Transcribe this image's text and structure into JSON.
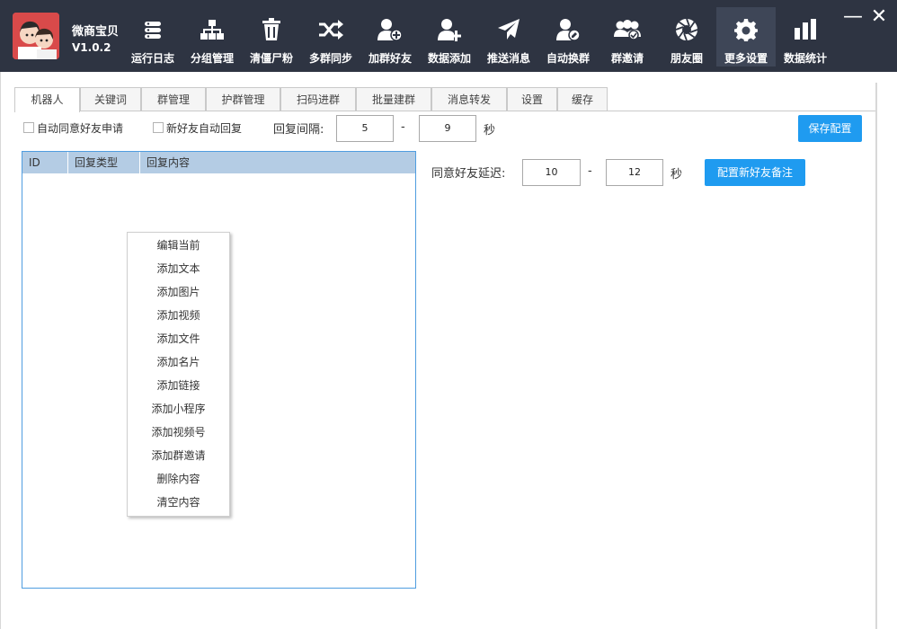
{
  "app": {
    "name": "微商宝贝",
    "version": "V1.0.2"
  },
  "nav": [
    {
      "label": "运行日志",
      "icon": "log-icon"
    },
    {
      "label": "分组管理",
      "icon": "group-tree-icon"
    },
    {
      "label": "清僵尸粉",
      "icon": "trash-icon"
    },
    {
      "label": "多群同步",
      "icon": "shuffle-icon"
    },
    {
      "label": "加群好友",
      "icon": "add-group-friend-icon"
    },
    {
      "label": "数据添加",
      "icon": "add-user-icon"
    },
    {
      "label": "推送消息",
      "icon": "send-icon"
    },
    {
      "label": "自动换群",
      "icon": "user-edit-icon"
    },
    {
      "label": "群邀请",
      "icon": "group-invite-icon"
    },
    {
      "label": "朋友圈",
      "icon": "aperture-icon"
    },
    {
      "label": "更多设置",
      "icon": "gear-icon",
      "active": true
    },
    {
      "label": "数据统计",
      "icon": "bar-chart-icon"
    }
  ],
  "window": {
    "minimize": "—",
    "close": "✕"
  },
  "tabs": [
    "机器人",
    "关键词",
    "群管理",
    "护群管理",
    "扫码进群",
    "批量建群",
    "消息转发",
    "设置",
    "缓存"
  ],
  "row1": {
    "auto_accept_label": "自动同意好友申请",
    "new_friend_reply_label": "新好友自动回复",
    "reply_interval_label": "回复间隔:",
    "reply_min": "5",
    "dash": "-",
    "reply_max": "9",
    "unit": "秒",
    "save_button": "保存配置"
  },
  "row2": {
    "delay_label": "同意好友延迟:",
    "delay_min": "10",
    "dash": "-",
    "delay_max": "12",
    "unit": "秒",
    "remark_button": "配置新好友备注"
  },
  "list": {
    "columns": [
      "ID",
      "回复类型",
      "回复内容"
    ]
  },
  "context_menu": [
    "编辑当前",
    "添加文本",
    "添加图片",
    "添加视频",
    "添加文件",
    "添加名片",
    "添加链接",
    "添加小程序",
    "添加视频号",
    "添加群邀请",
    "删除内容",
    "清空内容"
  ],
  "colors": {
    "header_bg": "#2e3442",
    "accent": "#1f9bf0",
    "list_header": "#b4cce4",
    "list_border": "#4f9de0"
  }
}
